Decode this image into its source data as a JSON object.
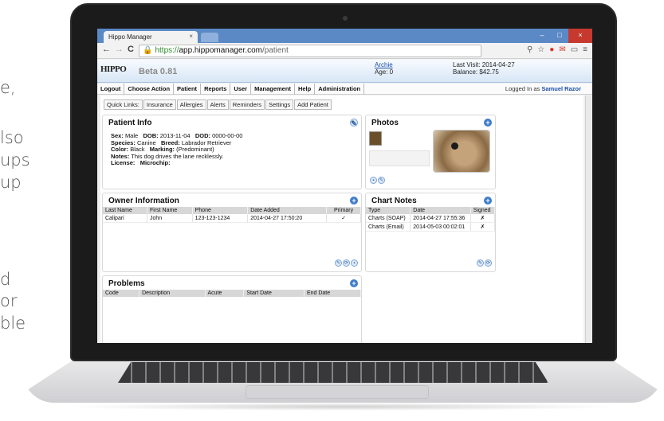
{
  "side_text": [
    "e,",
    "lso",
    "ups",
    "up",
    "d",
    "or",
    "ble"
  ],
  "browser": {
    "tab_title": "Hippo Manager",
    "tab_close": "×",
    "url_secure": "https://",
    "url_host": "app.hippomanager.com",
    "url_path": "/patient",
    "nav_back": "←",
    "nav_forward": "→",
    "nav_reload": "C",
    "window_min": "–",
    "window_max": "□",
    "window_close": "×"
  },
  "app": {
    "logo": "HIPPO",
    "version": "Beta 0.81",
    "patient_name": "Archie",
    "patient_age": "Age: 0",
    "last_visit": "Last Visit: 2014-04-27",
    "balance": "Balance: $42.75",
    "logged_in_label": "Logged In as",
    "logged_in_user": "Samuel Razor"
  },
  "menu": [
    "Logout",
    "Choose Action",
    "Patient",
    "Reports",
    "User",
    "Management",
    "Help",
    "Administration"
  ],
  "quick_links": [
    "Quick Links:",
    "Insurance",
    "Allergies",
    "Alerts",
    "Reminders",
    "Settings",
    "Add Patient"
  ],
  "patient_info": {
    "title": "Patient Info",
    "sex_label": "Sex:",
    "sex": "Male",
    "dob_label": "DOB:",
    "dob": "2013-11-04",
    "dod_label": "DOD:",
    "dod": "0000-00-00",
    "species_label": "Species:",
    "species": "Canine",
    "breed_label": "Breed:",
    "breed": "Labrador Retriever",
    "color_label": "Color:",
    "color": "Black",
    "marking_label": "Marking:",
    "marking": "(Predominant)",
    "notes_label": "Notes:",
    "notes": "This dog drives the lane recklessly.",
    "license_label": "License:",
    "microchip_label": "Microchip:"
  },
  "photos": {
    "title": "Photos"
  },
  "owner": {
    "title": "Owner Information",
    "columns": [
      "Last Name",
      "First Name",
      "Phone",
      "Date Added",
      "Primary"
    ],
    "rows": [
      [
        "Calipari",
        "John",
        "123-123-1234",
        "2014-04-27 17:50:20",
        "✓"
      ]
    ]
  },
  "chart_notes": {
    "title": "Chart Notes",
    "columns": [
      "Type",
      "Date",
      "Signed"
    ],
    "rows": [
      [
        "Charts (SOAP)",
        "2014-04-27 17:55:36",
        "✗"
      ],
      [
        "Charts (Email)",
        "2014-05-03 00:02:01",
        "✗"
      ]
    ]
  },
  "problems": {
    "title": "Problems",
    "columns": [
      "Code",
      "Description",
      "Acute",
      "Start Date",
      "End Date"
    ]
  },
  "icons": {
    "plus": "+",
    "edit": "✎",
    "refresh": "⟳",
    "delete": "▪"
  }
}
